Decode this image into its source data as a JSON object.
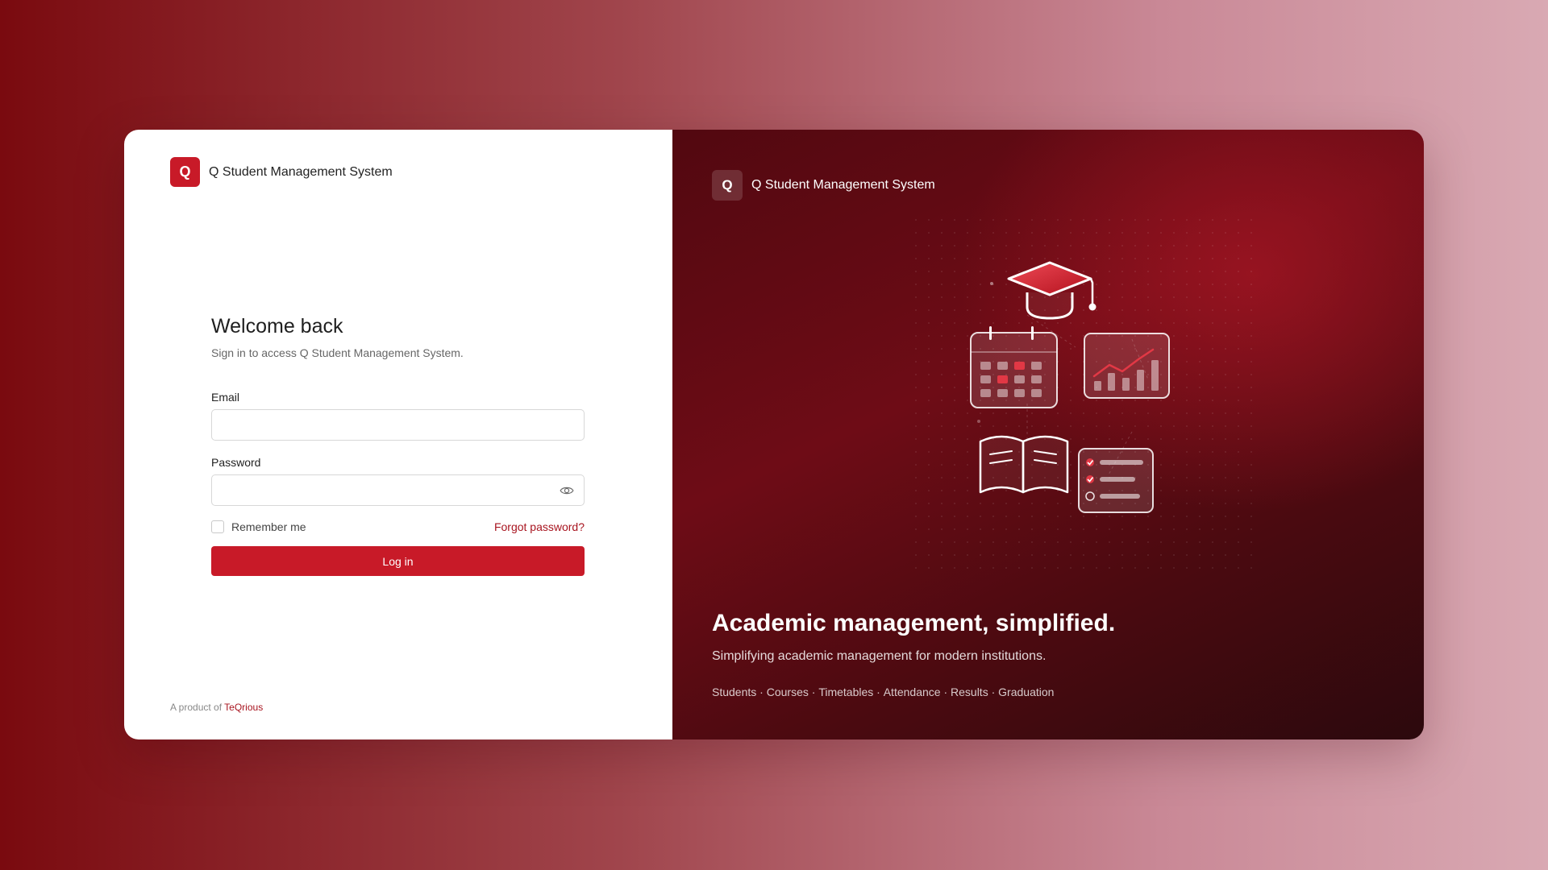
{
  "brand": {
    "logo_letter": "Q",
    "name": "Q Student Management System"
  },
  "login": {
    "title": "Welcome back",
    "subtitle": "Sign in to access Q Student Management System.",
    "email_label": "Email",
    "email_value": "",
    "password_label": "Password",
    "password_value": "",
    "remember_label": "Remember me",
    "remember_checked": false,
    "forgot_label": "Forgot password?",
    "login_label": "Log in"
  },
  "footer": {
    "prefix": "A product of",
    "company": "TeQrious"
  },
  "hero": {
    "headline": "Academic management, simplified.",
    "tagline": "Simplifying academic management for modern institutions.",
    "features": [
      "Students",
      "Courses",
      "Timetables",
      "Attendance",
      "Results",
      "Graduation"
    ],
    "separator": " · "
  },
  "colors": {
    "accent": "#c81a28",
    "link": "#a8141f",
    "hero_dark": "#520810"
  },
  "icons": [
    "eye-icon",
    "graduation-cap-icon",
    "calendar-icon",
    "chart-icon",
    "book-icon",
    "checklist-icon"
  ]
}
